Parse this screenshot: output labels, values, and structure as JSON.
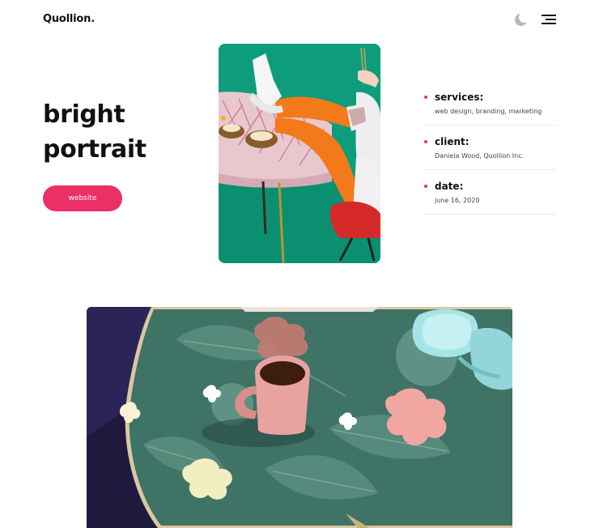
{
  "header": {
    "logo_text": "Quollion.",
    "theme_toggle_icon": "moon-icon",
    "menu_icon": "hamburger-menu-icon"
  },
  "project": {
    "title_line1": "bright",
    "title_line2": "portrait",
    "website_button_label": "website"
  },
  "meta": {
    "items": [
      {
        "label": "services:",
        "value": "web design, branding, marketing"
      },
      {
        "label": "client:",
        "value": "Daniela Wood, Quollion Inc."
      },
      {
        "label": "date:",
        "value": "june 16, 2020"
      }
    ]
  },
  "colors": {
    "accent": "#ec2f66",
    "teal_background": "#0e9d7c",
    "dark_purple": "#1f1a3d"
  }
}
